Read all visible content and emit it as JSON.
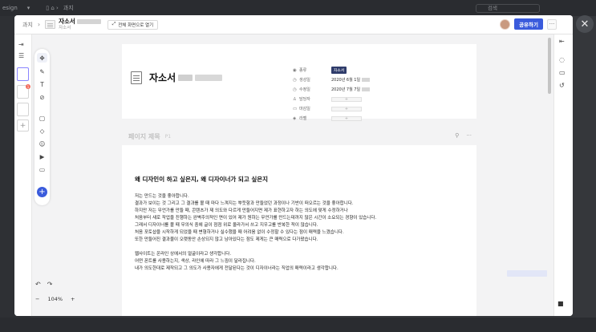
{
  "background": {
    "app_label": "esign",
    "breadcrumb_right": "과지",
    "search_placeholder": "검색"
  },
  "header": {
    "crumb": "과지",
    "doc_title": "자소서",
    "doc_subtitle": "자소서",
    "fullscreen_label": "전체 화면으로 열기",
    "share_label": "공유하기",
    "more": "···"
  },
  "document": {
    "title": "자소서",
    "properties": [
      {
        "icon": "◉",
        "label": "종류",
        "value": "자소서",
        "kind": "tag"
      },
      {
        "icon": "◷",
        "label": "생성일",
        "value": "2020년 6월 1일",
        "kind": "date"
      },
      {
        "icon": "◷",
        "label": "수정일",
        "value": "2020년 7월 7일",
        "kind": "date"
      },
      {
        "icon": "♙",
        "label": "담당자",
        "value": "+",
        "kind": "box"
      },
      {
        "icon": "▭",
        "label": "마감일",
        "value": "+",
        "kind": "box"
      },
      {
        "icon": "◈",
        "label": "라벨",
        "value": "+",
        "kind": "box"
      }
    ]
  },
  "section": {
    "title": "페이지 제목",
    "page_label": "P1",
    "heading": "왜 디자인이 하고 싶은지, 왜 디자이너가 되고 싶은지",
    "paragraph1": [
      "저는 만드는 것을 좋아합니다.",
      "결과가 보이는 것 그리고 그 결과를 볼 때 마다 느껴지는 뿌듯함과 만들었던 과정이나 기반이 떠오르는 것을 좋아합니다.",
      "하지만 저는 무언가를 만들 때, 콘텐츠가 제 의도와 다르게 만들어지면 제가 표현하고자 하는 의도에 맞게 수정하거나",
      "처음부터 새로 작업을 진행하는 완벽주의적인 면이 있어 제가 원하는 무언가를 만드는데까지 많은 시간이 소요되는 경향이 있습니다.",
      "그래서 디자이너를 볼 때 무의식 중에 글이 점점 위로 올라가서 쓰고 지우고를 반복한 적이 많습니다.",
      "처음 포토샵을 시작하게 되었을 때 변형하거나 실수했을 때 어려움 없이 수정할 수 있다는 점이 매력을 느꼈습니다.",
      "또한 만들어진 결과물이 오랫동안 손상되지 않고 남아있다는 점도 제게는 큰 매력으로 다가왔습니다."
    ],
    "paragraph2": [
      "웹사이트는 온라인 상에서의 얼굴이라고 생각합니다.",
      "어떤 폰트를 사용하는지, 색상, 라인에 따라 그 느낌이 달라집니다.",
      "내가 의도한대로 제작되고 그 의도가 사용자에게 전달된다는 것이 디자이너라는 직업의 매력이라고 생각합니다."
    ]
  },
  "zoom": {
    "minus": "−",
    "value": "104%",
    "plus": "+"
  }
}
